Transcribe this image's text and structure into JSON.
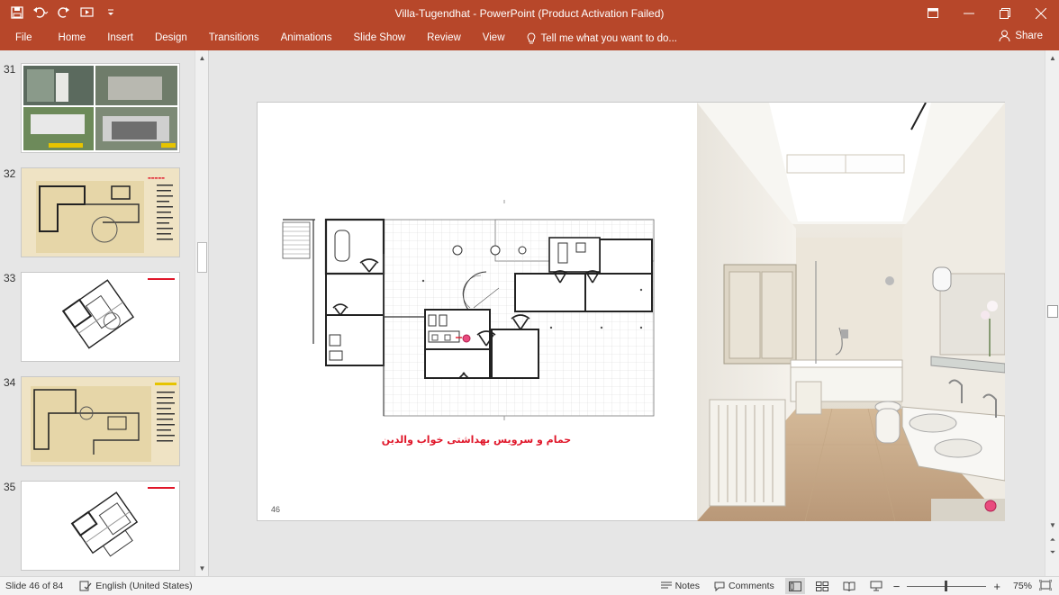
{
  "window": {
    "title": "Villa-Tugendhat - PowerPoint (Product Activation Failed)",
    "accent": "#b7472a"
  },
  "ribbon": {
    "tabs": [
      "File",
      "Home",
      "Insert",
      "Design",
      "Transitions",
      "Animations",
      "Slide Show",
      "Review",
      "View"
    ],
    "tell_me": "Tell me what you want to do...",
    "share": "Share"
  },
  "thumbnails": [
    {
      "number": "31"
    },
    {
      "number": "32"
    },
    {
      "number": "33"
    },
    {
      "number": "34"
    },
    {
      "number": "35"
    }
  ],
  "slide": {
    "caption": "حمام و سرویس بهداشتی خواب والدین",
    "page_number": "46"
  },
  "status": {
    "slide_position": "Slide 46 of 84",
    "language": "English (United States)",
    "notes": "Notes",
    "comments": "Comments",
    "zoom": "75%"
  }
}
